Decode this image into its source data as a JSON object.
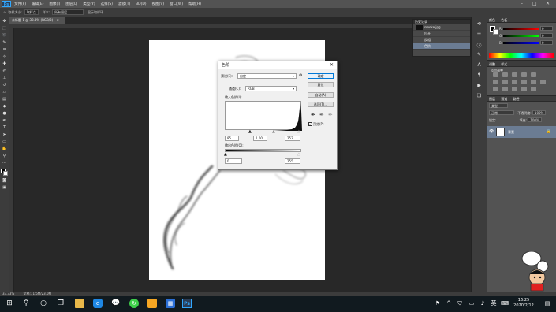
{
  "menubar": {
    "logo": "Ps",
    "items": [
      "文件(F)",
      "编辑(E)",
      "图像(I)",
      "图层(L)",
      "类型(Y)",
      "选择(S)",
      "滤镜(T)",
      "3D(D)",
      "视图(V)",
      "窗口(W)",
      "帮助(H)"
    ],
    "win_min": "–",
    "win_max": "□",
    "win_close": "✕"
  },
  "options": {
    "tool_icon": "✧",
    "size_label": "取样大小:",
    "size_value": "取样点",
    "sample_label": "样本:",
    "sample_value": "所有图层",
    "checkbox_label": "显示取样环"
  },
  "document": {
    "tab_title": "未标题-1 @ 33.3% (RGB/8)",
    "tab_close": "×",
    "zoom": "33.33%",
    "doc_size": "文档:11.5M/23.0M"
  },
  "history": {
    "header": "历史记录",
    "snapshot": "smoke.jpg",
    "states": [
      "打开",
      "反相",
      "色阶"
    ]
  },
  "color_panel": {
    "tabs": [
      "颜色",
      "色板"
    ],
    "channels": [
      {
        "label": "R",
        "value": "0"
      },
      {
        "label": "G",
        "value": "0"
      },
      {
        "label": "B",
        "value": "0"
      }
    ]
  },
  "adjust_panel": {
    "tabs": [
      "调整",
      "样式"
    ],
    "subtitle": "添加调整"
  },
  "layers_panel": {
    "tabs": [
      "图层",
      "通道",
      "路径"
    ],
    "kind": "类型",
    "blend": "正常",
    "opacity_label": "不透明度:",
    "opacity": "100%",
    "lock_label": "锁定:",
    "fill_label": "填充:",
    "fill": "100%",
    "layer_name": "背景",
    "eye": "👁",
    "lock_icon": "🔒"
  },
  "dialog": {
    "title": "色阶",
    "close": "✕",
    "preset_label": "预设(E):",
    "preset_value": "自定",
    "gear": "⚙",
    "channel_label": "通道(C):",
    "channel_value": "RGB",
    "input_label": "输入色阶(I):",
    "input_black": "85",
    "input_gamma": "1.00",
    "input_white": "252",
    "output_label": "输出色阶(O):",
    "output_black": "0",
    "output_white": "255",
    "buttons": [
      "确定",
      "复位",
      "自动(A)",
      "选项(T)..."
    ],
    "preview_label": "预览(P)",
    "preview_checked": "✓"
  },
  "taskbar": {
    "time": "16:25",
    "date": "2020/2/12",
    "lang": "英"
  }
}
